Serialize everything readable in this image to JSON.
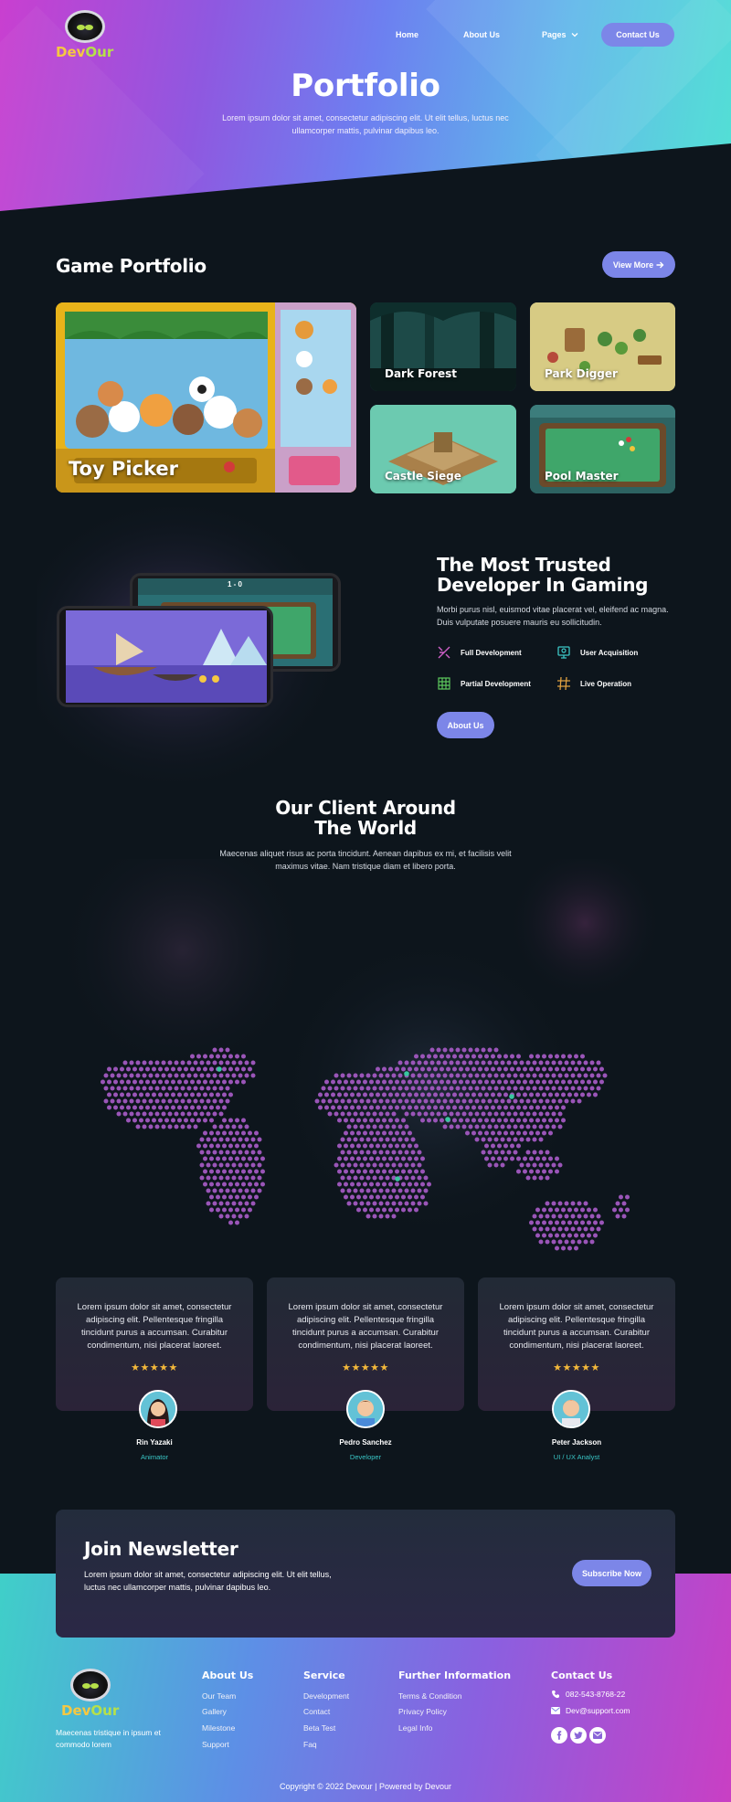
{
  "header": {
    "logo_a": "Dev",
    "logo_b": "Our",
    "nav": [
      "Home",
      "About Us",
      "Pages",
      "Contact Us"
    ],
    "title": "Portfolio",
    "subtitle": "Lorem ipsum dolor sit amet, consectetur adipiscing elit. Ut elit tellus, luctus nec ullamcorper mattis, pulvinar dapibus leo."
  },
  "portfolio": {
    "title": "Game Portfolio",
    "view_more": "View More",
    "games": [
      "Toy Picker",
      "Dark Forest",
      "Park Digger",
      "Castle Siege",
      "Pool Master"
    ]
  },
  "trusted": {
    "title_line1": "The Most Trusted",
    "title_line2": "Developer In Gaming",
    "text": "Morbi purus nisl, euismod vitae placerat vel, eleifend ac magna. Duis vulputate posuere mauris eu sollicitudin.",
    "features": [
      "Full Development",
      "User Acquisition",
      "Partial Development",
      "Live Operation"
    ],
    "button": "About Us",
    "pool_score": "1 - 0"
  },
  "clients": {
    "title_line1": "Our Client Around",
    "title_line2": "The World",
    "text": "Maecenas aliquet risus ac porta tincidunt. Aenean dapibus ex mi, et facilisis velit maximus vitae. Nam tristique diam et libero porta."
  },
  "testimonials": [
    {
      "text": "Lorem ipsum dolor sit amet, consectetur adipiscing elit. Pellentesque fringilla tincidunt purus a accumsan. Curabitur condimentum, nisi placerat laoreet.",
      "stars": "★★★★★",
      "name": "Rin Yazaki",
      "role": "Animator"
    },
    {
      "text": "Lorem ipsum dolor sit amet, consectetur adipiscing elit. Pellentesque fringilla tincidunt purus a accumsan. Curabitur condimentum, nisi placerat laoreet.",
      "stars": "★★★★★",
      "name": "Pedro Sanchez",
      "role": "Developer"
    },
    {
      "text": "Lorem ipsum dolor sit amet, consectetur adipiscing elit. Pellentesque fringilla tincidunt purus a accumsan. Curabitur condimentum, nisi placerat laoreet.",
      "stars": "★★★★★",
      "name": "Peter Jackson",
      "role": "UI / UX Analyst"
    }
  ],
  "newsletter": {
    "title": "Join Newsletter",
    "text": "Lorem ipsum dolor sit amet, consectetur adipiscing elit. Ut elit tellus, luctus nec ullamcorper mattis, pulvinar dapibus leo.",
    "button": "Subscribe Now"
  },
  "footer": {
    "tagline": "Maecenas tristique in ipsum et commodo lorem",
    "about": {
      "title": "About Us",
      "links": [
        "Our Team",
        "Gallery",
        "Milestone",
        "Support"
      ]
    },
    "service": {
      "title": "Service",
      "links": [
        "Development",
        "Contact",
        "Beta Test",
        "Faq"
      ]
    },
    "further": {
      "title": "Further Information",
      "links": [
        "Terms & Condition",
        "Privacy Policy",
        "Legal Info"
      ]
    },
    "contact": {
      "title": "Contact Us",
      "phone": "082-543-8768-22",
      "email": "Dev@support.com"
    },
    "copyright": "Copyright © 2022 Devour | Powered by Devour"
  },
  "colors": {
    "accent": "#7c86e8",
    "teal": "#39c6c6",
    "star": "#f3b83a",
    "background": "#0d151c"
  }
}
